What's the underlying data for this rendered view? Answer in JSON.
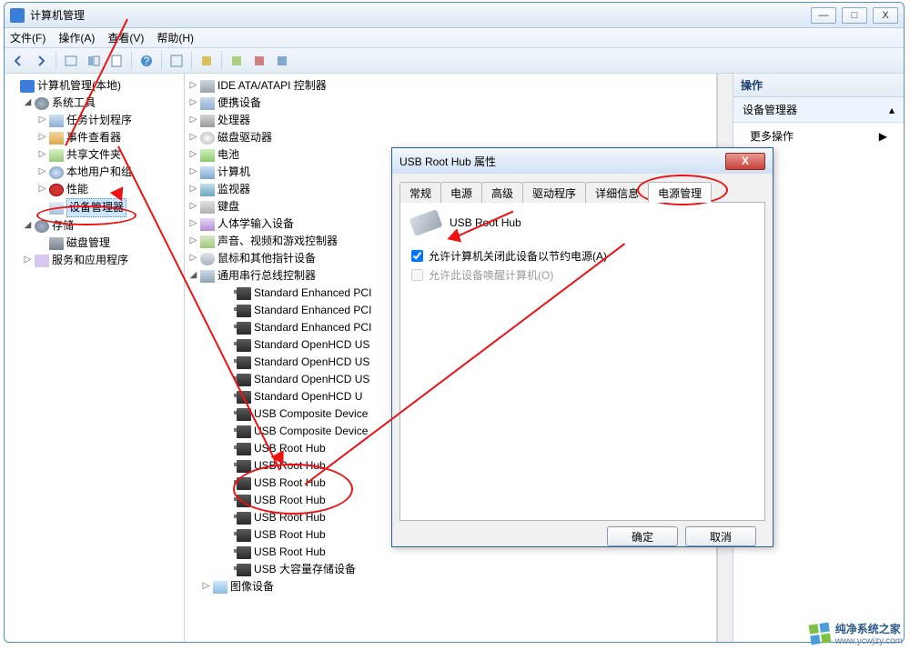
{
  "window": {
    "title": "计算机管理"
  },
  "winbtns": {
    "min": "—",
    "max": "□",
    "close": "X"
  },
  "menu": {
    "file": "文件(F)",
    "action": "操作(A)",
    "view": "查看(V)",
    "help": "帮助(H)"
  },
  "leftTree": {
    "root": "计算机管理(本地)",
    "systools": "系统工具",
    "task": "任务计划程序",
    "event": "事件查看器",
    "share": "共享文件夹",
    "users": "本地用户和组",
    "perf": "性能",
    "devmgr": "设备管理器",
    "storage": "存储",
    "disk": "磁盘管理",
    "services": "服务和应用程序"
  },
  "devTree": {
    "ide": "IDE ATA/ATAPI 控制器",
    "portable": "便携设备",
    "cpu": "处理器",
    "cdrom": "磁盘驱动器",
    "battery": "电池",
    "computer": "计算机",
    "monitor": "监视器",
    "keyboard": "键盘",
    "hid": "人体学输入设备",
    "sound": "声音、视频和游戏控制器",
    "mouse": "鼠标和其他指针设备",
    "usb": "通用串行总线控制器",
    "usbItems": [
      "Standard Enhanced PCI",
      "Standard Enhanced PCI",
      "Standard Enhanced PCI",
      "Standard OpenHCD US",
      "Standard OpenHCD US",
      "Standard OpenHCD US",
      "Standard OpenHCD U",
      "USB Composite Device",
      "USB Composite Device",
      "USB Root Hub",
      "USB Root Hub",
      "USB Root Hub",
      "USB Root Hub",
      "USB Root Hub",
      "USB Root Hub",
      "USB Root Hub",
      "USB 大容量存储设备"
    ],
    "imaging": "图像设备"
  },
  "actions": {
    "header": "操作",
    "devmgr": "设备管理器",
    "more": "更多操作"
  },
  "dialog": {
    "title": "USB Root Hub 属性",
    "tabs": {
      "general": "常规",
      "power": "电源",
      "advanced": "高级",
      "driver": "驱动程序",
      "details": "详细信息",
      "powermgmt": "电源管理"
    },
    "devname": "USB Root Hub",
    "chk1": "允许计算机关闭此设备以节约电源(A)",
    "chk2": "允许此设备唤醒计算机(O)",
    "ok": "确定",
    "cancel": "取消"
  },
  "watermark": {
    "text": "纯净系统之家",
    "url": "www.ycwjzy.com"
  }
}
